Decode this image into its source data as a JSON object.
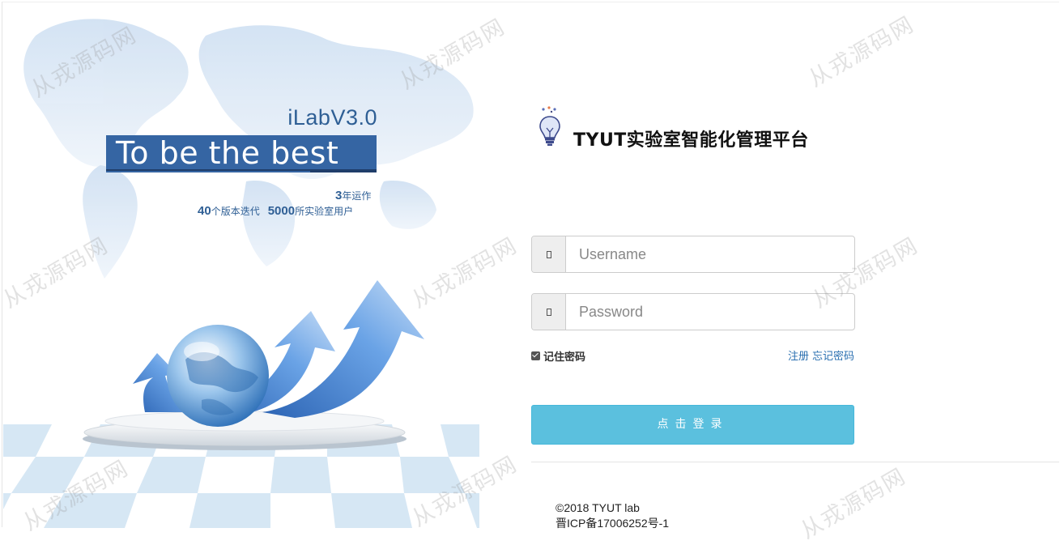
{
  "hero": {
    "version": "iLabV3.0",
    "slogan": "To be the best",
    "stats": {
      "years_number": "3",
      "years_text": "年运作",
      "versions_number": "40",
      "versions_text": "个版本迭代",
      "labs_number": "5000",
      "labs_text": "所实验室用户"
    }
  },
  "app": {
    "title": "TYUT实验室智能化管理平台",
    "logo_icon": "lightbulb-icon"
  },
  "form": {
    "username": {
      "placeholder": "Username",
      "value": "",
      "icon": "user-icon"
    },
    "password": {
      "placeholder": "Password",
      "value": "",
      "icon": "lock-icon"
    },
    "remember_label": "记住密码",
    "remember_checked": true,
    "register_link": "注册",
    "forgot_link": "忘记密码",
    "submit_label": "点击登录"
  },
  "footer": {
    "copyright": "©2018 TYUT lab",
    "icp": "晋ICP备17006252号-1"
  },
  "watermark": "从戎源码网",
  "colors": {
    "primary_button": "#5bc0de",
    "brand_blue": "#3565a3",
    "link": "#2a6fb0"
  }
}
